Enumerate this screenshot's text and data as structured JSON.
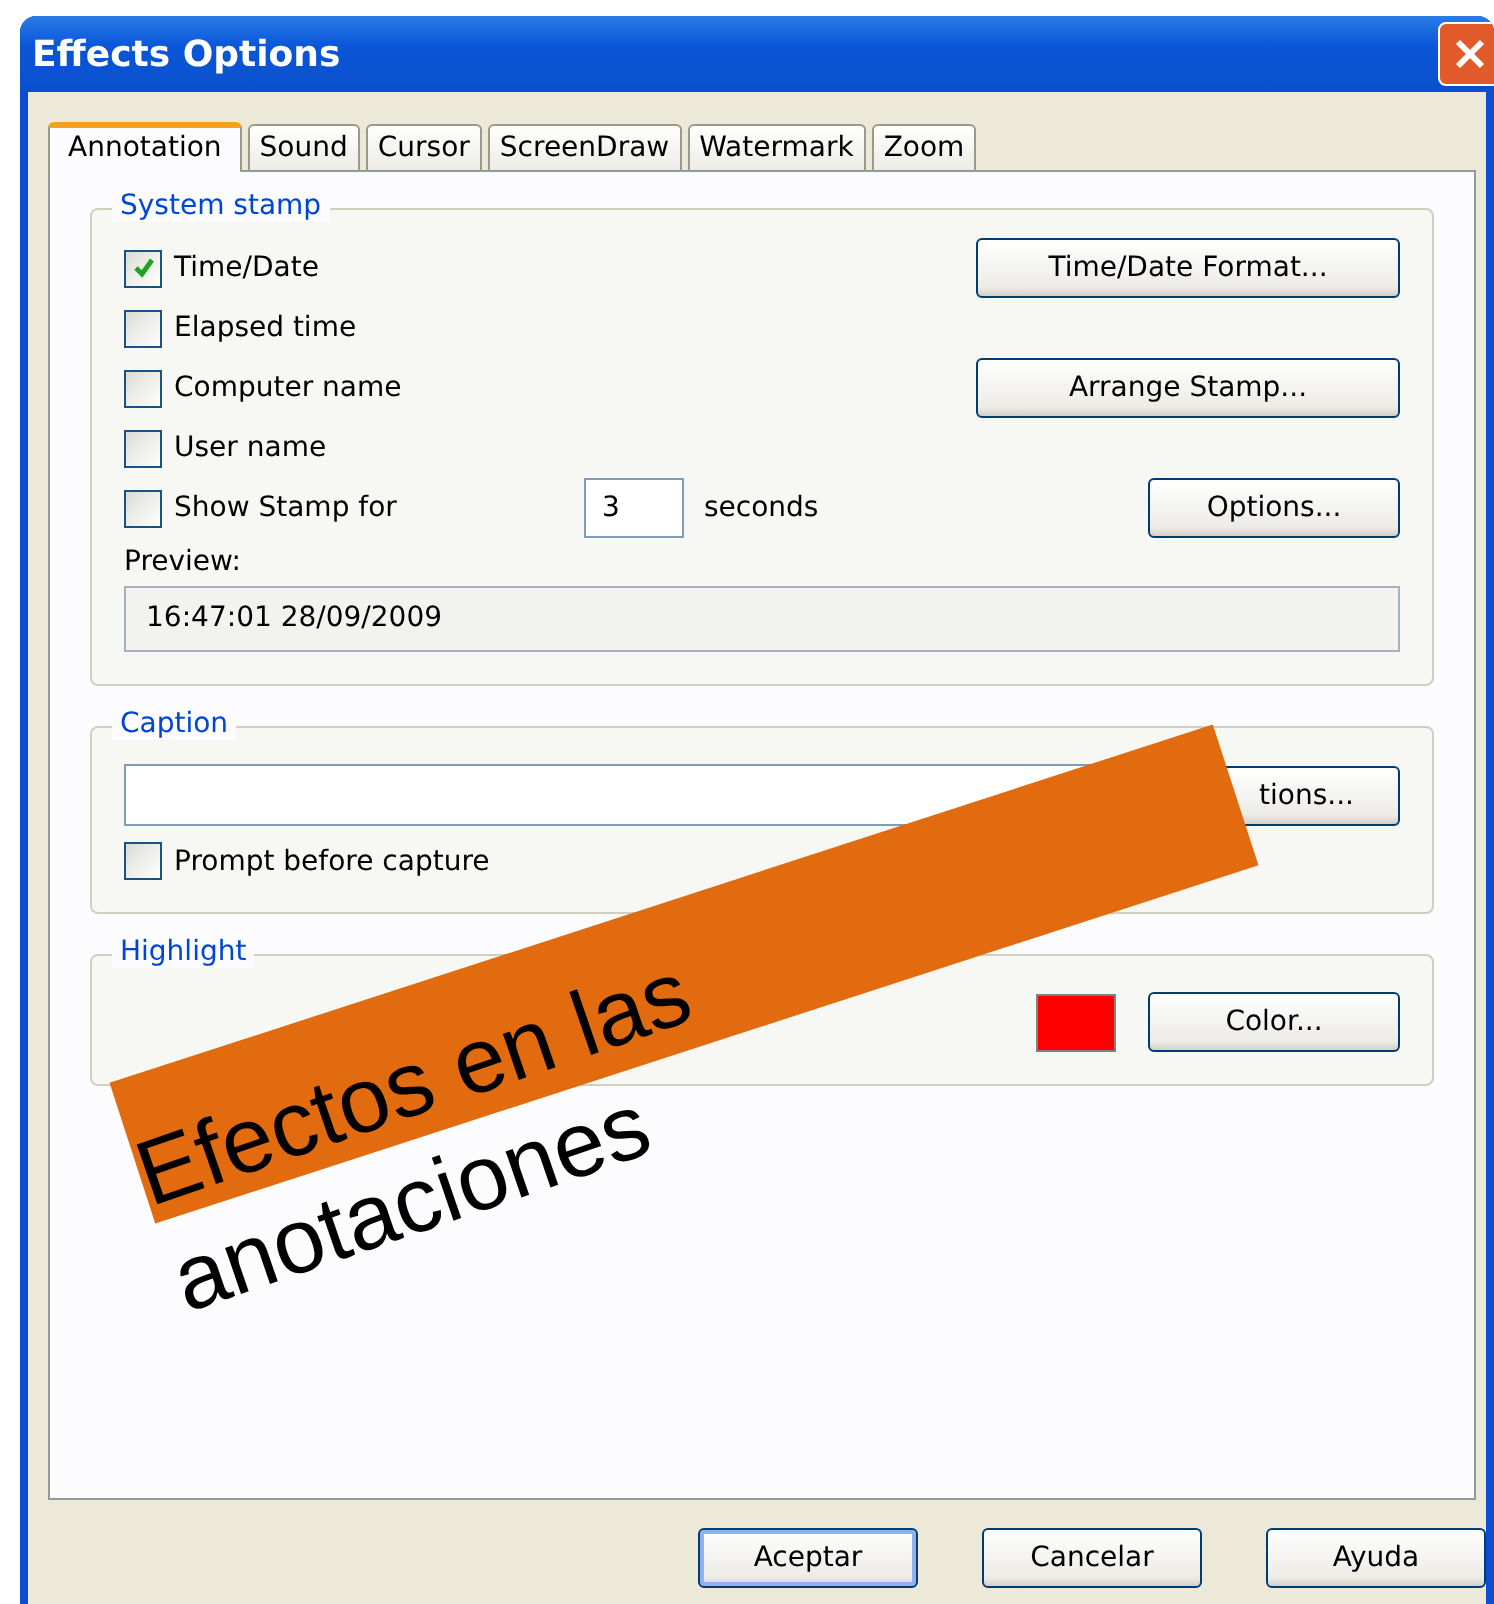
{
  "window": {
    "title": "Effects Options"
  },
  "tabs": [
    {
      "label": "Annotation",
      "selected": true
    },
    {
      "label": "Sound",
      "selected": false
    },
    {
      "label": "Cursor",
      "selected": false
    },
    {
      "label": "ScreenDraw",
      "selected": false
    },
    {
      "label": "Watermark",
      "selected": false
    },
    {
      "label": "Zoom",
      "selected": false
    }
  ],
  "system_stamp": {
    "title": "System stamp",
    "options": [
      {
        "label": "Time/Date",
        "checked": true,
        "button": "Time/Date Format..."
      },
      {
        "label": "Elapsed time",
        "checked": false
      },
      {
        "label": "Computer name",
        "checked": false,
        "button": "Arrange Stamp..."
      },
      {
        "label": "User name",
        "checked": false
      },
      {
        "label": "Show Stamp for",
        "checked": false,
        "value": "3",
        "unit": "seconds",
        "button": "Options..."
      }
    ],
    "preview_label": "Preview:",
    "preview": "16:47:01 28/09/2009"
  },
  "caption": {
    "title": "Caption",
    "button": "tions...",
    "prompt": {
      "label": "Prompt before capture",
      "checked": false
    }
  },
  "highlight": {
    "title": "Highlight",
    "color": "#ff0000",
    "button": "Color..."
  },
  "buttons": [
    {
      "label": "Aceptar",
      "default": true
    },
    {
      "label": "Cancelar",
      "default": false
    },
    {
      "label": "Ayuda",
      "default": false
    }
  ],
  "annotation": {
    "text": "Efectos en las anotaciones"
  }
}
